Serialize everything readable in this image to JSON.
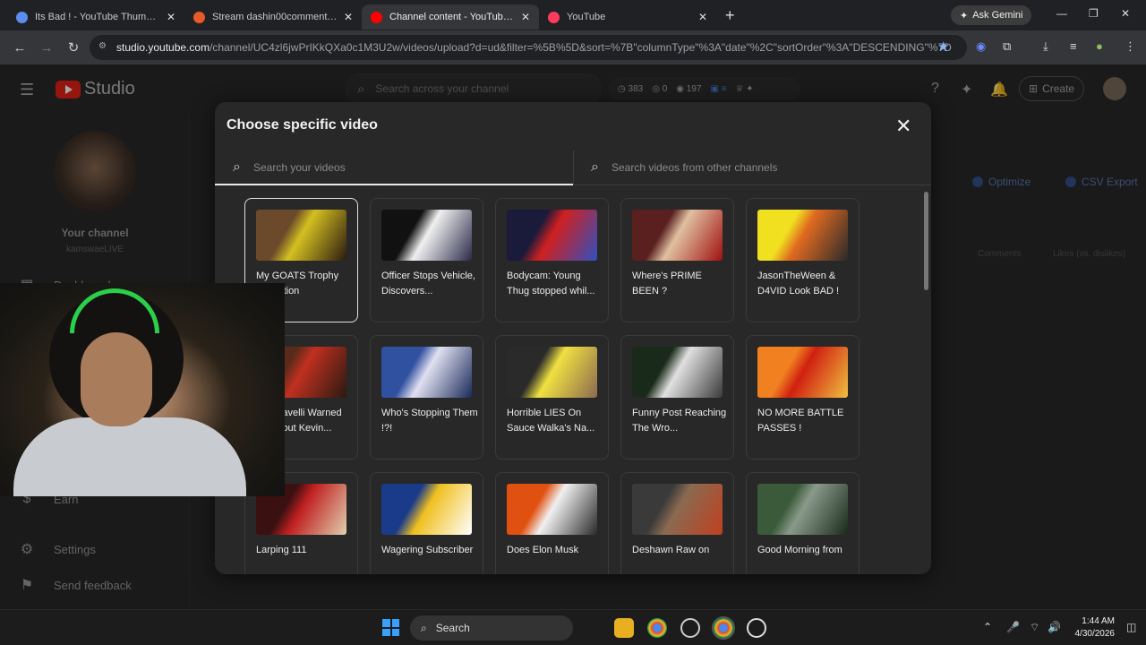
{
  "browser": {
    "tabs": [
      {
        "title": "Its Bad ! - YouTube Thumbnail",
        "favicon_color": "#5b8def"
      },
      {
        "title": "Stream dashin00commentt|files",
        "favicon_color": "#e85a2a"
      },
      {
        "title": "Channel content - YouTube Studio",
        "favicon_color": "#ff0000"
      },
      {
        "title": "YouTube",
        "favicon_color": "#ff3b5c"
      }
    ],
    "new_tab": "+",
    "ask_gemini": "Ask Gemini",
    "url_host": "studio.youtube.com",
    "url_path": "/channel/UC4zl6jwPrIKkQXa0c1M3U2w/videos/upload?d=ud&filter=%5B%5D&sort=%7B\"columnType\"%3A\"date\"%2C\"sortOrder\"%3A\"DESCENDING\"%7D"
  },
  "studio": {
    "logo_text": "Studio",
    "search_placeholder": "Search across your channel",
    "stats": {
      "views": "383",
      "comments": "0",
      "subs": "197"
    },
    "create_label": "Create",
    "channel_name": "Your channel",
    "channel_handle": "kamswaeLIVE",
    "sidebar": [
      {
        "label": "Dashboard",
        "icon": "dashboard-icon"
      },
      {
        "label": "Earn",
        "icon": "dollar-icon"
      },
      {
        "label": "Settings",
        "icon": "gear-icon"
      },
      {
        "label": "Send feedback",
        "icon": "feedback-icon"
      }
    ],
    "bg_tabs": [
      "Optimize",
      "CSV Export"
    ],
    "bg_cols": [
      "Comments",
      "Likes (vs. dislikes)"
    ]
  },
  "modal": {
    "title": "Choose specific video",
    "search_own_placeholder": "Search your videos",
    "search_other_placeholder": "Search videos from other channels",
    "videos": [
      {
        "title": "My GOATS Trophy Collection",
        "colors": [
          "#6a4a2a",
          "#d4c020",
          "#2a1a10"
        ]
      },
      {
        "title": "Officer Stops Vehicle, Discovers...",
        "colors": [
          "#111111",
          "#f0f0f0",
          "#2a2a4a"
        ]
      },
      {
        "title": "Bodycam: Young Thug stopped whil...",
        "colors": [
          "#1a1a3a",
          "#d02020",
          "#3050c0"
        ]
      },
      {
        "title": "Where's PRIME BEEN ?",
        "colors": [
          "#5a2020",
          "#e0c0a0",
          "#a01010"
        ]
      },
      {
        "title": "JasonTheWeen & D4VID Look BAD !",
        "colors": [
          "#f0e020",
          "#e06a20",
          "#2a2a2a"
        ]
      },
      {
        "title": "Machiavelli Warned Us About Kevin...",
        "colors": [
          "#5a2a1a",
          "#c03020",
          "#2a1a10"
        ]
      },
      {
        "title": "Who's Stopping Them !?!",
        "colors": [
          "#3050a0",
          "#e0e0f0",
          "#1a2a5a"
        ]
      },
      {
        "title": "Horrible LIES On Sauce Walka's Na...",
        "colors": [
          "#2a2a2a",
          "#f0e040",
          "#8a6a50"
        ]
      },
      {
        "title": "Funny Post Reaching The Wro...",
        "colors": [
          "#1a2a1a",
          "#e0e0e0",
          "#3a3a3a"
        ]
      },
      {
        "title": "NO MORE BATTLE PASSES !",
        "colors": [
          "#f08020",
          "#d02010",
          "#f0c040"
        ]
      },
      {
        "title": "Larping 111",
        "colors": [
          "#3a1010",
          "#c02020",
          "#e0d0b0"
        ]
      },
      {
        "title": "Wagering Subscriber",
        "colors": [
          "#1a3a8a",
          "#f0c020",
          "#ffffff"
        ]
      },
      {
        "title": "Does Elon Musk",
        "colors": [
          "#e05010",
          "#f0f0f0",
          "#2a2a2a"
        ]
      },
      {
        "title": "Deshawn Raw on",
        "colors": [
          "#3a3a3a",
          "#8a6a50",
          "#c04020"
        ]
      },
      {
        "title": "Good Morning from",
        "colors": [
          "#3a5a3a",
          "#8a9a8a",
          "#1a2a1a"
        ]
      }
    ]
  },
  "taskbar": {
    "search_label": "Search",
    "time": "1:44 AM",
    "date": "4/30/2026"
  }
}
